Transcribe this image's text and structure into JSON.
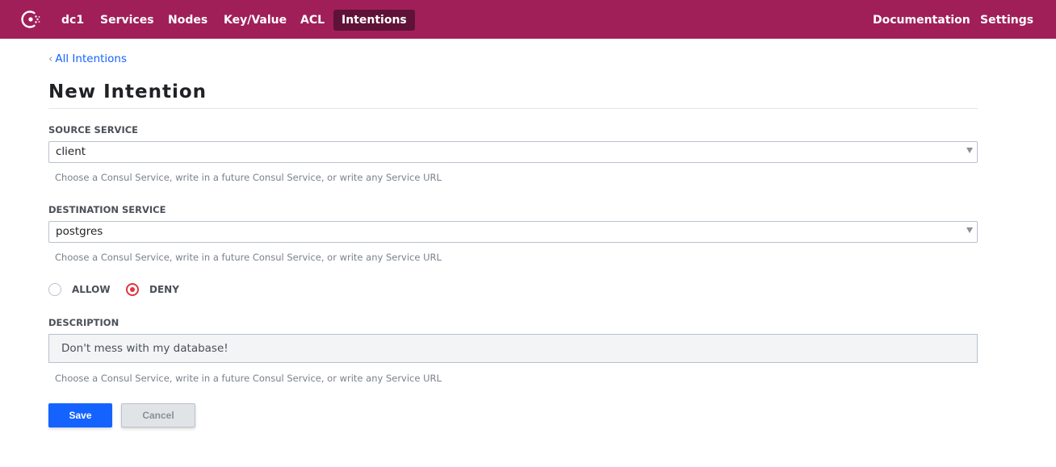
{
  "nav": {
    "datacenter": "dc1",
    "items": [
      {
        "label": "Services"
      },
      {
        "label": "Nodes"
      },
      {
        "label": "Key/Value"
      },
      {
        "label": "ACL"
      },
      {
        "label": "Intentions",
        "active": true
      }
    ],
    "right": [
      {
        "label": "Documentation"
      },
      {
        "label": "Settings"
      }
    ]
  },
  "breadcrumb": {
    "label": "All Intentions"
  },
  "page": {
    "title": "New Intention"
  },
  "form": {
    "source": {
      "label": "SOURCE SERVICE",
      "value": "client",
      "help": "Choose a Consul Service, write in a future Consul Service, or write any Service URL"
    },
    "destination": {
      "label": "DESTINATION SERVICE",
      "value": "postgres",
      "help": "Choose a Consul Service, write in a future Consul Service, or write any Service URL"
    },
    "action": {
      "options": [
        {
          "label": "ALLOW",
          "checked": false
        },
        {
          "label": "DENY",
          "checked": true
        }
      ]
    },
    "description": {
      "label": "DESCRIPTION",
      "value": "Don't mess with my database!",
      "help": "Choose a Consul Service, write in a future Consul Service, or write any Service URL"
    }
  },
  "buttons": {
    "save": "Save",
    "cancel": "Cancel"
  },
  "colors": {
    "topbar": "#a01f59",
    "topbar_active": "#5f1237",
    "primary": "#1563ff",
    "radio_checked": "#e0353f"
  },
  "icons": {
    "logo": "consul-logo-icon",
    "back": "chevron-left-icon",
    "caret": "caret-down-icon"
  }
}
